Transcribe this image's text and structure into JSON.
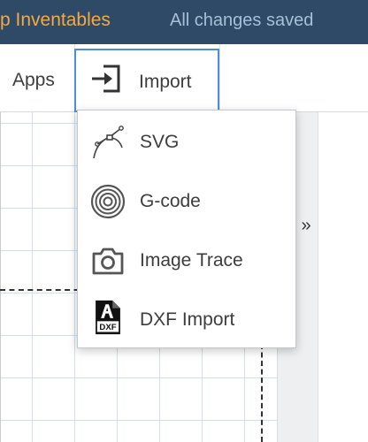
{
  "header": {
    "project_title": "p Inventables",
    "save_status": "All changes saved"
  },
  "toolbar": {
    "apps_label": "Apps",
    "import_label": "Import"
  },
  "side_panel": {
    "toggle_glyph": "»"
  },
  "import_menu": {
    "items": [
      {
        "label": "SVG",
        "icon": "svg-pen-icon"
      },
      {
        "label": "G-code",
        "icon": "gcode-circles-icon"
      },
      {
        "label": "Image Trace",
        "icon": "camera-icon"
      },
      {
        "label": "DXF Import",
        "icon": "dxf-file-icon"
      }
    ],
    "dxf_badge_text": "DXF"
  },
  "colors": {
    "header_bg": "#2f4a66",
    "project_title": "#f3a944",
    "save_status": "#a7bfd8",
    "focus_outline": "#4a90d9",
    "grid_line": "#cfe0ef"
  }
}
